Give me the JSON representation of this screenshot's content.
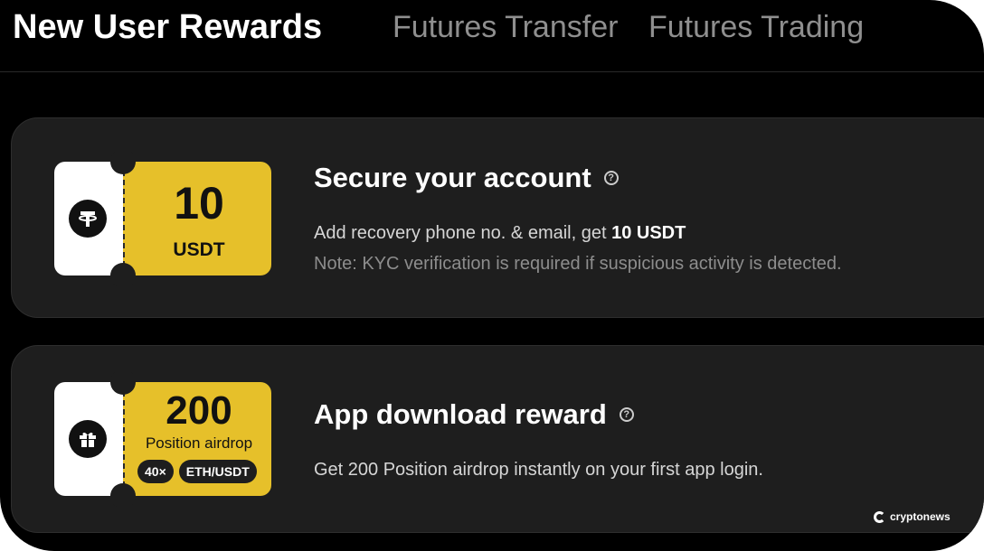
{
  "tabs": [
    "New User Rewards",
    "Futures Transfer",
    "Futures Trading"
  ],
  "cards": [
    {
      "title": "Secure your account",
      "description_prefix": "Add recovery phone no. & email, get ",
      "description_bold": "10 USDT",
      "note": "Note: KYC verification is required if suspicious activity is detected.",
      "ticket": {
        "amount": "10",
        "unit": "USDT",
        "icon": "tether-icon"
      }
    },
    {
      "title": "App download reward",
      "description": "Get 200 Position airdrop instantly on your first app login.",
      "ticket": {
        "amount": "200",
        "unit": "Position airdrop",
        "leverage": "40×",
        "pair": "ETH/USDT",
        "icon": "gift-icon"
      }
    }
  ],
  "watermark": "cryptonews",
  "colors": {
    "ticket": "#e6c02a",
    "card": "#1e1e1e",
    "background": "#000000"
  }
}
